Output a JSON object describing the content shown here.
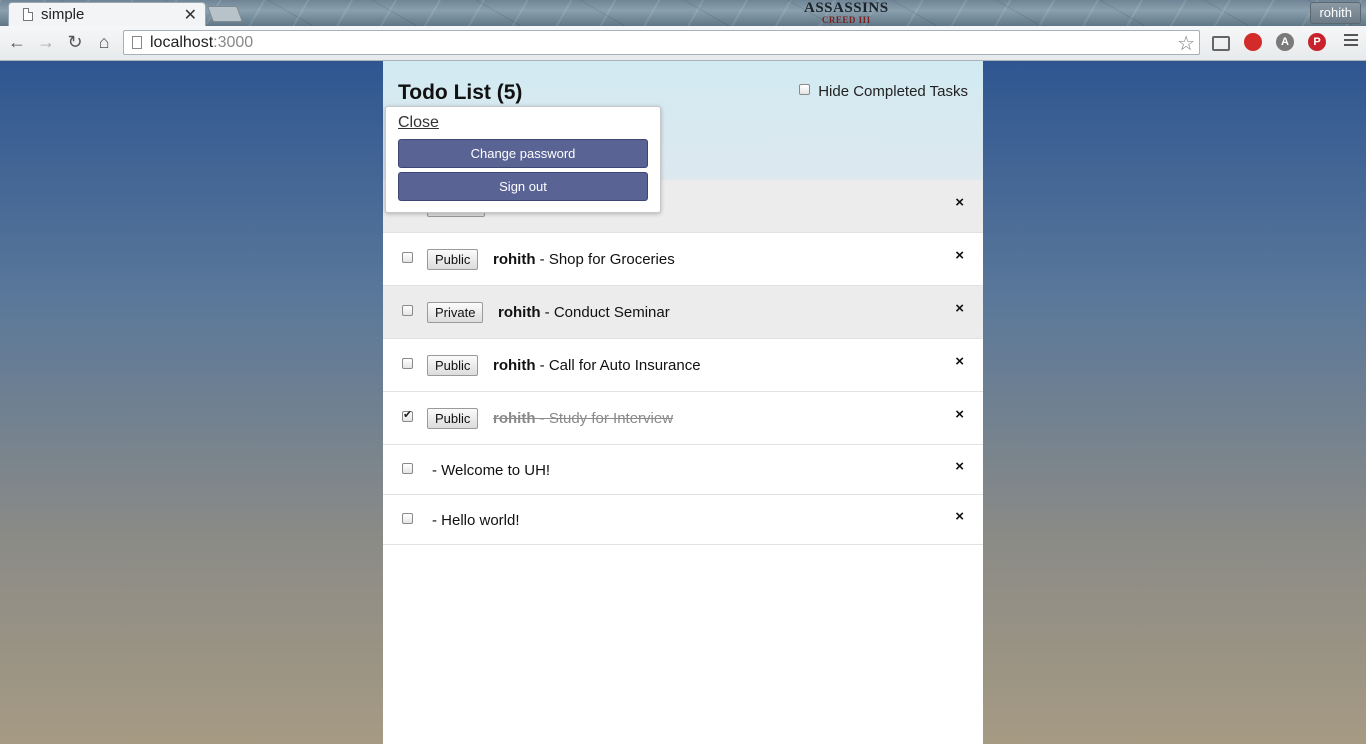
{
  "browser": {
    "tab_title": "simple",
    "tab_close": "✕",
    "theme_logo": "ASSASSINS",
    "theme_logo_sub": "CREED III",
    "profile_name": "rohith",
    "url_host": "localhost",
    "url_port": ":3000",
    "star": "☆",
    "nav": {
      "back": "←",
      "forward": "→",
      "reload": "↻",
      "home": "⌂"
    }
  },
  "header": {
    "title": "Todo List (5)",
    "hide_completed_label": "Hide Completed Tasks"
  },
  "popup": {
    "close_label": "Close",
    "change_password_label": "Change password",
    "sign_out_label": "Sign out"
  },
  "tasks": [
    {
      "checked": false,
      "privacy": "",
      "owner": "",
      "text": "",
      "alt": true
    },
    {
      "checked": false,
      "privacy": "Public",
      "owner": "rohith",
      "text": " - Shop for Groceries"
    },
    {
      "checked": false,
      "privacy": "Private",
      "owner": "rohith",
      "text": " - Conduct Seminar",
      "alt": true
    },
    {
      "checked": false,
      "privacy": "Public",
      "owner": "rohith",
      "text": " - Call for Auto Insurance"
    },
    {
      "checked": true,
      "privacy": "Public",
      "owner": "rohith",
      "text": " - Study for Interview"
    },
    {
      "checked": false,
      "privacy": "",
      "owner": "",
      "text": "- Welcome to UH!"
    },
    {
      "checked": false,
      "privacy": "",
      "owner": "",
      "text": "- Hello world!"
    }
  ],
  "delete_glyph": "×"
}
